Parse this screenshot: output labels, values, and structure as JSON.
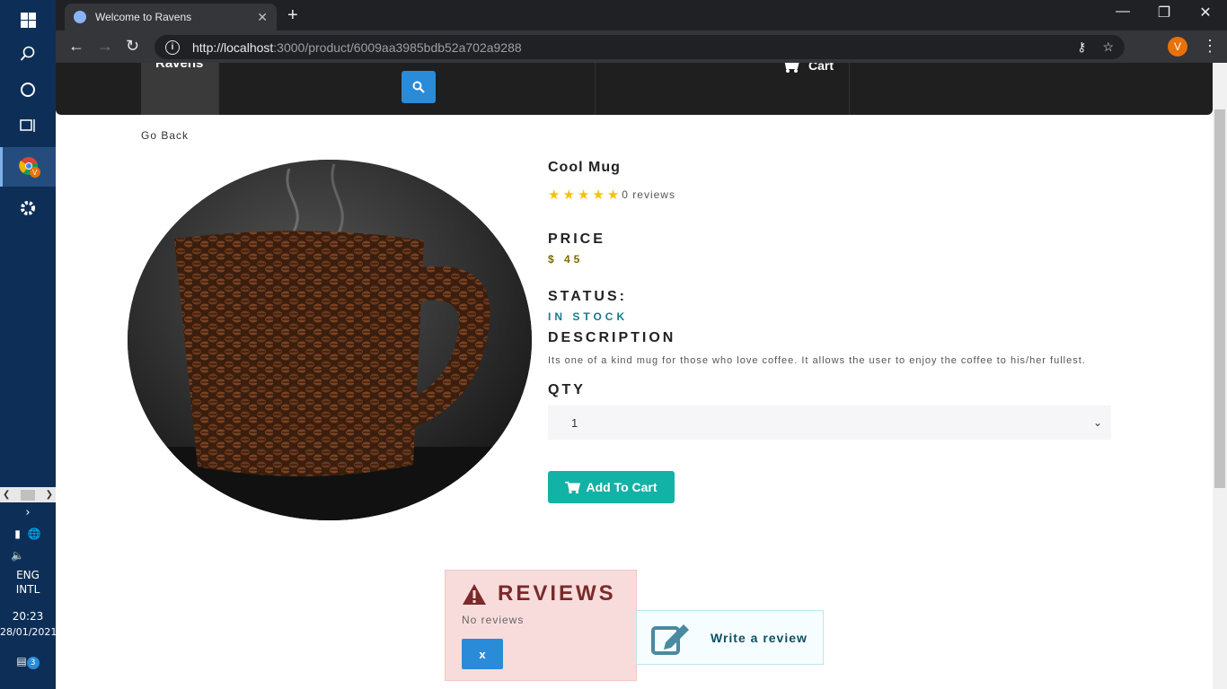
{
  "taskbar": {
    "language": "ENG",
    "layout": "INTL",
    "time": "20:23",
    "date": "28/01/2021",
    "notifications": "3",
    "chrome_badge": "V"
  },
  "browser": {
    "tab_title": "Welcome to Ravens",
    "url_host": "http://localhost",
    "url_path": ":3000/product/6009aa3985bdb52a702a9288",
    "profile_initial": "V"
  },
  "navbar": {
    "brand": "Ravens",
    "cart": "Cart"
  },
  "page": {
    "go_back": "Go Back"
  },
  "product": {
    "name": "Cool Mug",
    "rating": 5,
    "reviews_text": "0 reviews",
    "price_heading": "PRICE",
    "price": "$ 45",
    "status_heading": "STATUS:",
    "status": "IN STOCK",
    "description_heading": "DESCRIPTION",
    "description": "Its one of a kind mug for those who love coffee. It allows the user to enjoy the coffee to his/her fullest.",
    "qty_heading": "QTY",
    "qty_value": "1",
    "add_to_cart": "Add To Cart"
  },
  "reviews": {
    "title": "REVIEWS",
    "empty": "No reviews",
    "close": "x",
    "write_review": "Write a review"
  },
  "colors": {
    "accent": "#13b2a6",
    "primary": "#2a8bd8",
    "star": "#f8c009",
    "danger_bg": "#f8dcdc"
  }
}
